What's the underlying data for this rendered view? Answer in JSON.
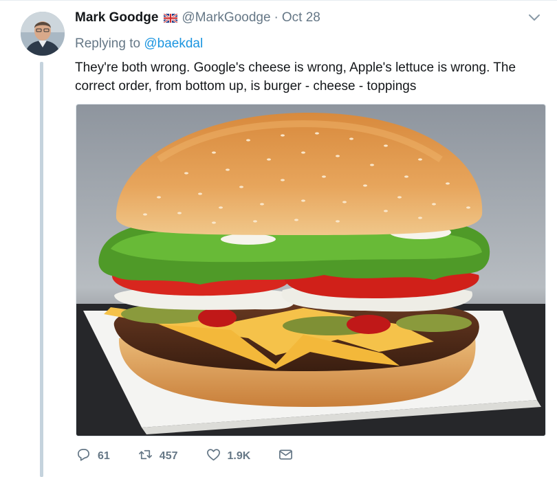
{
  "tweet": {
    "author_name": "Mark Goodge",
    "handle": "@MarkGoodge",
    "separator": "·",
    "date": "Oct 28",
    "replying_prefix": "Replying to",
    "replying_to": "@baekdal",
    "text": "They're both wrong. Google's cheese is wrong, Apple's lettuce is wrong. The correct order, from bottom up, is burger - cheese - toppings",
    "flag": "uk-flag-icon",
    "caret": "chevron-down-icon"
  },
  "actions": {
    "replies": "61",
    "retweets": "457",
    "likes": "1.9K"
  },
  "colors": {
    "link": "#1b95e0",
    "secondary": "#657786",
    "thread_line": "#c5d3dd"
  }
}
